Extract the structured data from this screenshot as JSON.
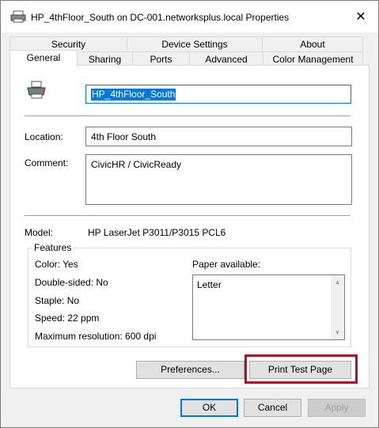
{
  "window": {
    "title": "HP_4thFloor_South on DC-001.networksplus.local Properties",
    "close_glyph": "✕"
  },
  "tabs_row1": [
    {
      "label": "Security"
    },
    {
      "label": "Device Settings"
    },
    {
      "label": "About"
    }
  ],
  "tabs_row2": [
    {
      "label": "General",
      "active": true
    },
    {
      "label": "Sharing"
    },
    {
      "label": "Ports"
    },
    {
      "label": "Advanced"
    },
    {
      "label": "Color Management"
    }
  ],
  "general": {
    "printer_name": "HP_4thFloor_South",
    "location_label": "Location:",
    "location_value": "4th Floor South",
    "comment_label": "Comment:",
    "comment_value": "CivicHR / CivicReady",
    "model_label": "Model:",
    "model_value": "HP LaserJet P3011/P3015 PCL6",
    "features": {
      "legend": "Features",
      "color": "Color: Yes",
      "double_sided": "Double-sided: No",
      "staple": "Staple: No",
      "speed": "Speed: 22 ppm",
      "max_resolution": "Maximum resolution: 600 dpi",
      "paper_label": "Paper available:",
      "paper_items": [
        "Letter"
      ]
    },
    "preferences_button": "Preferences...",
    "print_test_button": "Print Test Page"
  },
  "footer": {
    "ok": "OK",
    "cancel": "Cancel",
    "apply": "Apply"
  },
  "colors": {
    "accent": "#0078d7",
    "highlight": "#b0102a"
  }
}
